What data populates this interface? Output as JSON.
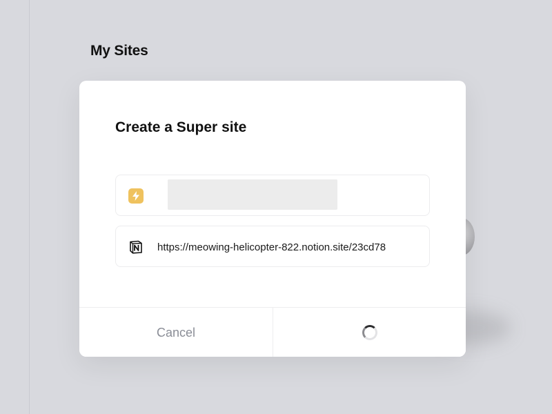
{
  "page": {
    "title": "My Sites"
  },
  "modal": {
    "title": "Create a Super site",
    "site_name_field": {
      "value": "",
      "icon": "lightning-bolt-icon"
    },
    "notion_url_field": {
      "value": "https://meowing-helicopter-822.notion.site/23cd78",
      "icon": "notion-logo-icon"
    },
    "cancel_label": "Cancel",
    "submit_state": "loading"
  },
  "colors": {
    "accent": "#efc25e",
    "background": "#d8d9de"
  }
}
